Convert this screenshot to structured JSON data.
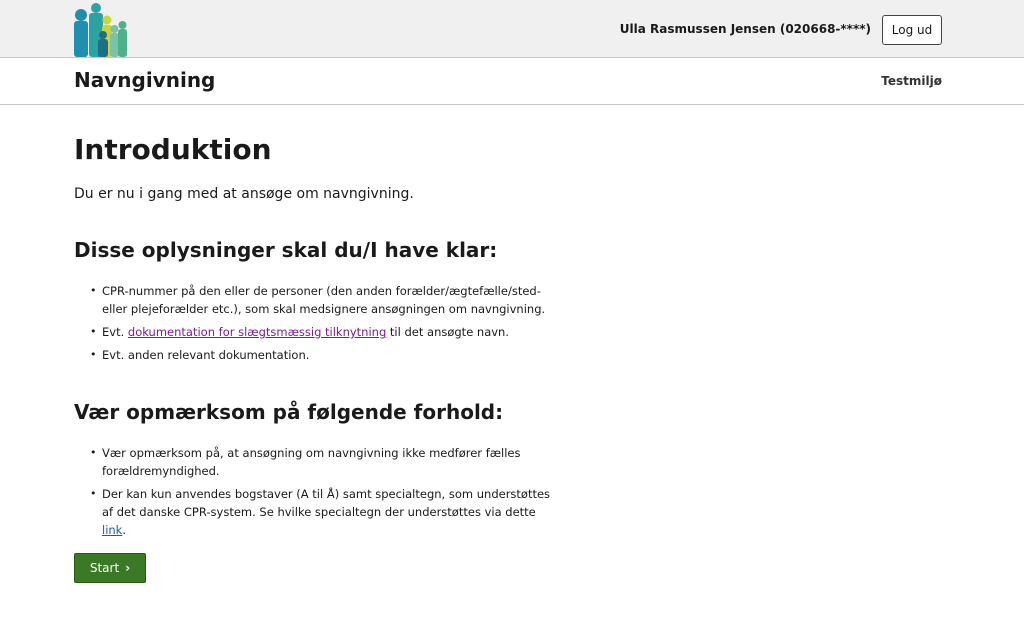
{
  "header": {
    "logo_icon": "family-logo-icon",
    "user_label": "Ulla Rasmussen Jensen (020668-****)",
    "logout_label": "Log ud"
  },
  "appbar": {
    "title": "Navngivning",
    "environment": "Testmiljø"
  },
  "main": {
    "title": "Introduktion",
    "intro": "Du er nu i gang med at ansøge om navngivning.",
    "section1": {
      "heading": "Disse oplysninger skal du/I have klar:",
      "item1": "CPR-nummer på den eller de personer (den anden forælder/ægtefælle/sted- eller plejeforælder etc.), som skal medsignere ansøgningen om navngivning.",
      "item2_prefix": "Evt.",
      "item2_link": "dokumentation for slægtsmæssig tilknytning",
      "item2_suffix": "til det ansøgte navn.",
      "item3": "Evt. anden relevant dokumentation."
    },
    "section2": {
      "heading": "Vær opmærksom på følgende forhold:",
      "item1": "Vær opmærksom på, at ansøgning om navngivning ikke medfører fælles forældremyndighed.",
      "item2_text": "Der kan kun anvendes bogstaver (A til Å) samt specialtegn, som understøttes af det danske CPR-system. Se hvilke specialtegn der understøttes via dette",
      "item2_link": "link",
      "item2_end": "."
    },
    "start_label": "Start",
    "start_icon": "chevron-right-icon"
  },
  "colors": {
    "start_button": "#3b7a25",
    "visited_link": "#7a1f8a",
    "link": "#1a5fa6",
    "topbar": "#f0f0f0"
  }
}
